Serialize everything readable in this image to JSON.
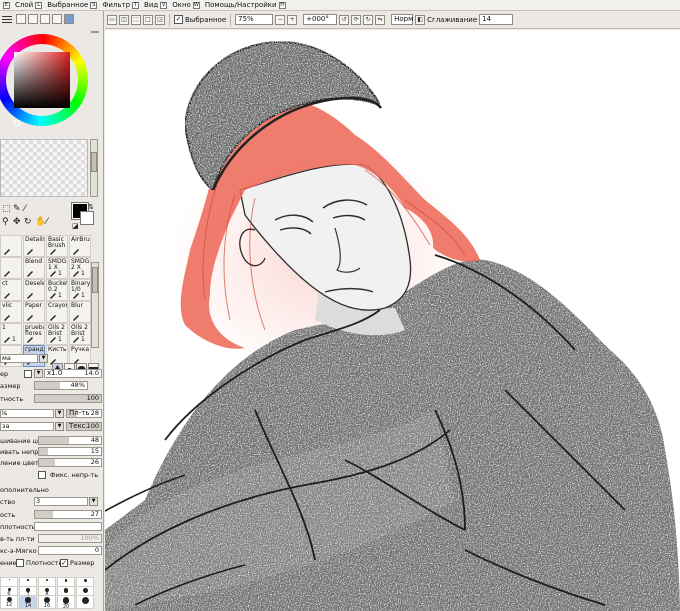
{
  "menu": {
    "items": [
      {
        "label": "Слой",
        "key": "L"
      },
      {
        "label": "Выбранное",
        "key": "S"
      },
      {
        "label": "Фильтр",
        "key": "T"
      },
      {
        "label": "Вид",
        "key": "V"
      },
      {
        "label": "Окно",
        "key": "W"
      },
      {
        "label": "Помощь/Настройки",
        "key": "H"
      }
    ],
    "first_key": "E"
  },
  "toolbar": {
    "selected_label": "Выбранное",
    "zoom": "75%",
    "rotation": "+000°",
    "mode": "Норм",
    "stabilizer_label": "Сглаживание",
    "stabilizer_value": "14"
  },
  "tools": {
    "brushes": [
      [
        "",
        "Details",
        "Basic Brush",
        "AirBrush"
      ],
      [
        "",
        "Blend",
        "SMDG 1 X",
        "SMDG 2 X"
      ],
      [
        "ct",
        "Deselect",
        "Bucket 0.2",
        "Binary 1/0"
      ],
      [
        "vlic",
        "Paper",
        "Crayon",
        "Blur"
      ],
      [
        "1",
        "prueba flores",
        "Oils 2 Brist",
        "Oils 2 Brist"
      ],
      [
        "",
        "грандж",
        "Кисть",
        "Ручка"
      ]
    ],
    "brush_numbers": [
      [
        "",
        "",
        "",
        ""
      ],
      [
        "",
        "",
        "1",
        "1"
      ],
      [
        "",
        "",
        "1",
        "1"
      ],
      [
        "",
        "",
        "",
        ""
      ],
      [
        "1",
        "",
        "1",
        "1"
      ],
      [
        "",
        "",
        "",
        ""
      ]
    ]
  },
  "properties": {
    "mode_label": "ма",
    "size_label": "ер",
    "size_mult": "x1.0",
    "size_value": "14.0",
    "min_size_label": "азмер",
    "min_size_value": "48%",
    "density_label": "тность",
    "density_value": "100",
    "texture_name": "ls",
    "texture_label": "Пл-ть",
    "texture_value": "28",
    "texture2_name": "за",
    "texture2_label": "Текс.",
    "texture2_value": "100",
    "blend_label": "шивание цвет",
    "blend_value": "48",
    "dilution_label": "ивать непр",
    "dilution_value": "15",
    "persistence_label": "ление цвет",
    "persistence_value": "26",
    "keep_opacity_label": "Фикс. непр-ть",
    "advanced_label": "ополнительно",
    "quality_label": "ство",
    "quality_value": "3",
    "edge_label": "ость",
    "edge_value": "27",
    "min_density_label": "плотность",
    "max_density_label": "в-ть пл-ти",
    "max_density_value": "100%",
    "pressure_label": "кс-э-Мягко",
    "pressure_value": "0",
    "pressure_opts_label": "ение:",
    "density_opt_label": "Плотность",
    "size_opt_label": "Размер"
  },
  "dot_sizes": {
    "row1": [
      "",
      "",
      "",
      "",
      ""
    ],
    "row2": [
      "6",
      "7",
      "8",
      "",
      ""
    ],
    "row3": [
      "12",
      "14",
      "16",
      "20",
      ""
    ]
  },
  "colors": {
    "panel": "#ece9e4",
    "primary": "#000000",
    "secondary": "#ffffff",
    "hair": "#ee6a5a",
    "shirt": "#6d6d6d",
    "selection": "#c6d4ec"
  }
}
